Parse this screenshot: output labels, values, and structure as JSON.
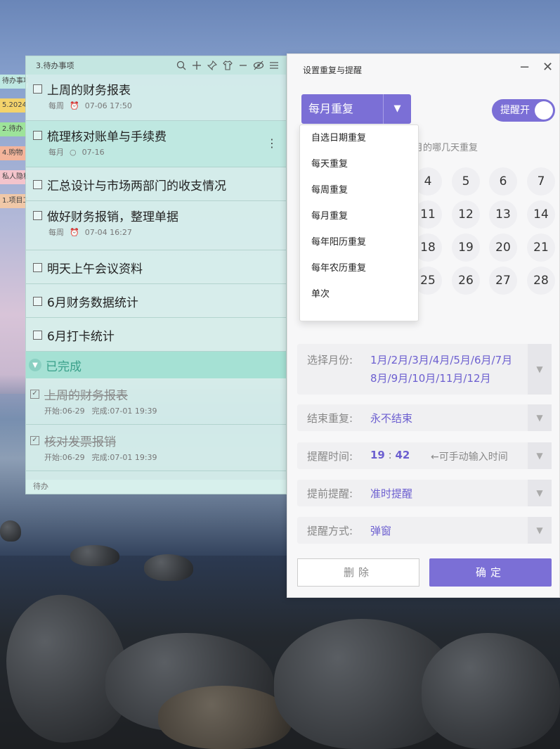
{
  "desktop": {
    "side_tags": [
      {
        "label": "待办事项",
        "color": "#bfe8e2"
      },
      {
        "label": "5.2024",
        "color": "#f3d36b"
      },
      {
        "label": "2.待办",
        "color": "#9de39a"
      },
      {
        "label": "4.购物",
        "color": "#f3b49a"
      },
      {
        "label": "私人隐私",
        "color": "#f4c4cc"
      },
      {
        "label": "1.项目工",
        "color": "#f0c8a8"
      }
    ]
  },
  "todo": {
    "title": "3.待办事项",
    "toolbar_icons": [
      "search-icon",
      "plus-icon",
      "pin-icon",
      "shirt-icon",
      "minimize-icon",
      "eye-off-icon",
      "menu-icon"
    ],
    "items": [
      {
        "title": "上周的财务报表",
        "repeat": "每周",
        "time": "07-06 17:50",
        "has_meta": true
      },
      {
        "title": "梳理核对账单与手续费",
        "repeat": "每月",
        "time": "07-16",
        "has_meta": true
      },
      {
        "title": "汇总设计与市场两部门的收支情况",
        "has_meta": false
      },
      {
        "title": "做好财务报销，整理单据",
        "repeat": "每周",
        "time": "07-04 16:27",
        "has_meta": true
      },
      {
        "title": "明天上午会议资料",
        "has_meta": false
      },
      {
        "title": "6月财务数据统计",
        "has_meta": false
      },
      {
        "title": "6月打卡统计",
        "has_meta": false
      }
    ],
    "completed_label": "已完成",
    "completed": [
      {
        "title": "上周的财务报表",
        "start": "开始:06-29",
        "done": "完成:07-01 19:39"
      },
      {
        "title": "核对发票报销",
        "start": "开始:06-29",
        "done": "完成:07-01 19:39"
      }
    ],
    "footer": "待办"
  },
  "dialog": {
    "title": "设置重复与提醒",
    "repeat_mode": "每月重复",
    "toggle_label": "提醒开",
    "hint": "月的哪几天重复",
    "visible_days": [
      "4",
      "5",
      "6",
      "7",
      "11",
      "12",
      "13",
      "14",
      "18",
      "19",
      "20",
      "21",
      "25",
      "26",
      "27",
      "28"
    ],
    "dropdown_options": [
      "自选日期重复",
      "每天重复",
      "每周重复",
      "每月重复",
      "每年阳历重复",
      "每年农历重复",
      "单次"
    ],
    "month_label": "选择月份:",
    "month_value_line1": "1月/2月/3月/4月/5月/6月/7月",
    "month_value_line2": "8月/9月/10月/11月/12月",
    "end_label": "结束重复:",
    "end_value": "永不结束",
    "time_label": "提醒时间:",
    "time_hour": "19",
    "time_minute": "42",
    "time_hint": "←可手动输入时间",
    "advance_label": "提前提醒:",
    "advance_value": "准时提醒",
    "method_label": "提醒方式:",
    "method_value": "弹窗",
    "delete_label": "删除",
    "confirm_label": "确定",
    "accent_color": "#7b6fd6"
  }
}
